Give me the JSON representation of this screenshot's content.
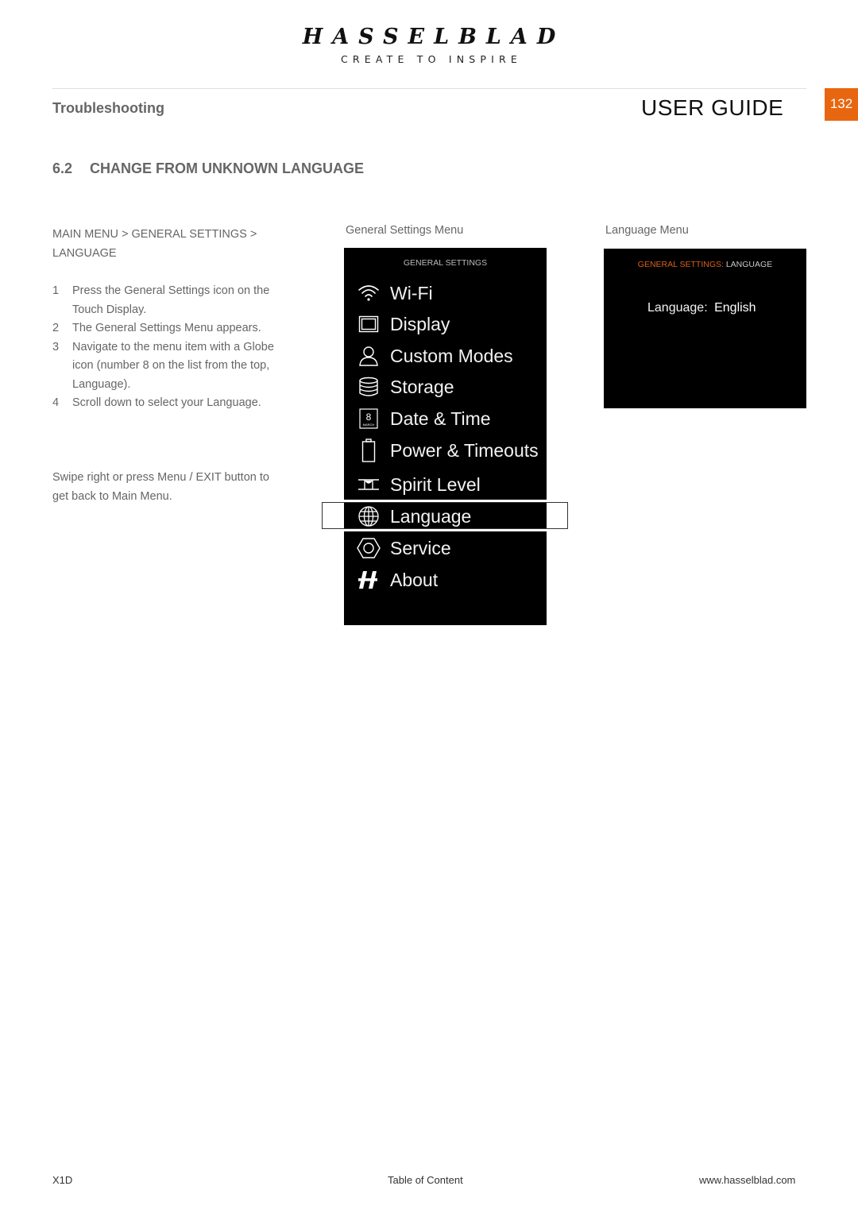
{
  "header": {
    "brand": "HASSELBLAD",
    "tagline": "CREATE TO INSPIRE",
    "section": "Troubleshooting",
    "guide_title": "USER GUIDE",
    "page_number": "132",
    "accent_color": "#e8660f"
  },
  "heading": {
    "number": "6.2",
    "title": "CHANGE FROM UNKNOWN LANGUAGE"
  },
  "instructions": {
    "breadcrumb": "MAIN MENU > GENERAL SETTINGS > LANGUAGE",
    "steps": [
      {
        "n": "1",
        "text": "Press the General Settings icon on the Touch Display."
      },
      {
        "n": "2",
        "text": "The General Settings Menu appears."
      },
      {
        "n": "3",
        "text": "Navigate to the menu item with a Globe icon (number 8 on the list from the top, Language)."
      },
      {
        "n": "4",
        "text": "Scroll down to select your Language."
      }
    ],
    "note": "Swipe right or press Menu / EXIT button to get back to Main Menu."
  },
  "general_settings_screen": {
    "caption": "General Settings Menu",
    "title": "GENERAL SETTINGS",
    "items": [
      {
        "label": "Wi-Fi",
        "icon": "wifi-icon"
      },
      {
        "label": "Display",
        "icon": "display-icon"
      },
      {
        "label": "Custom Modes",
        "icon": "user-icon"
      },
      {
        "label": "Storage",
        "icon": "storage-icon"
      },
      {
        "label": "Date & Time",
        "icon": "calendar-icon",
        "icon_day": "8",
        "icon_month": "MARCH"
      },
      {
        "label": "Power & Timeouts",
        "icon": "battery-icon"
      },
      {
        "label": "Spirit Level",
        "icon": "spirit-level-icon"
      },
      {
        "label": "Language",
        "icon": "globe-icon",
        "highlighted": true
      },
      {
        "label": "Service",
        "icon": "nut-icon"
      },
      {
        "label": "About",
        "icon": "hasselblad-h-icon"
      }
    ]
  },
  "language_screen": {
    "caption": "Language Menu",
    "title_prefix": "GENERAL SETTINGS:",
    "title_suffix": "LANGUAGE",
    "title_prefix_color": "#d9601b",
    "field_label": "Language:",
    "field_value": "English"
  },
  "footer": {
    "model": "X1D",
    "toc_link": "Table of Content",
    "website": "www.hasselblad.com"
  }
}
